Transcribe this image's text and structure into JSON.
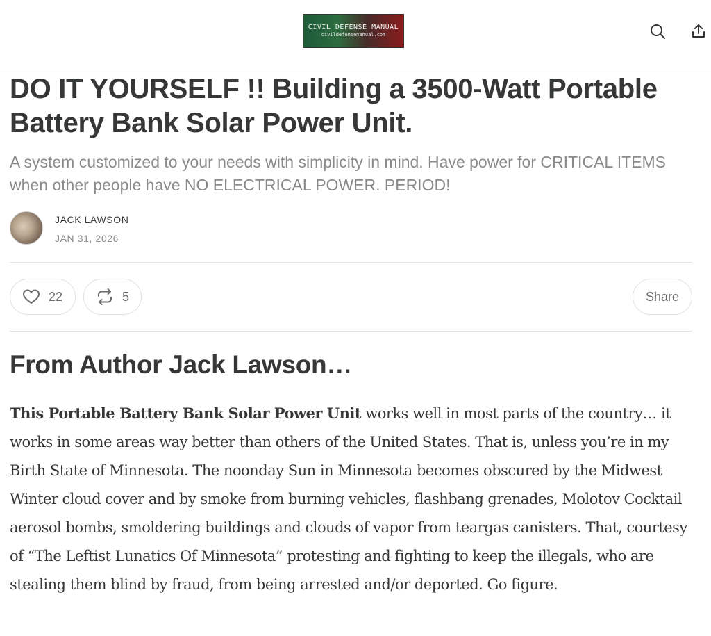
{
  "header": {
    "logo_title": "CIVIL DEFENSE MANUAL",
    "logo_subtitle": "civildefensemanual.com",
    "search_icon": "search-icon",
    "share_icon": "share-upload-icon"
  },
  "post": {
    "title": "DO IT YOURSELF !! Building a 3500-Watt Portable Battery Bank Solar Power Unit.",
    "subtitle": "A system customized to your needs with simplicity in mind. Have power for CRITICAL ITEMS when other people have NO ELECTRICAL POWER. PERIOD!",
    "author": "JACK LAWSON",
    "date": "JAN 31, 2026"
  },
  "actions": {
    "likes": "22",
    "restacks": "5",
    "share_label": "Share",
    "like_icon": "heart-icon",
    "restack_icon": "restack-icon"
  },
  "content": {
    "heading": "From Author Jack Lawson…",
    "lead_bold": "This Portable Battery Bank Solar Power Unit",
    "paragraph": " works well in most parts of the country… it works in some areas way better than others of the United States. That is, unless you’re in my Birth State of Minnesota. The noonday Sun in Minnesota becomes obscured by the Midwest Winter cloud cover and by smoke from burning vehicles, flashbang grenades, Molotov Cocktail aerosol bombs, smoldering buildings and clouds of vapor from teargas canisters. That, courtesy of “The Leftist Lunatics Of Minnesota” protesting and fighting to keep the illegals, who are stealing them blind by fraud, from being arrested and/or deported. Go figure."
  }
}
